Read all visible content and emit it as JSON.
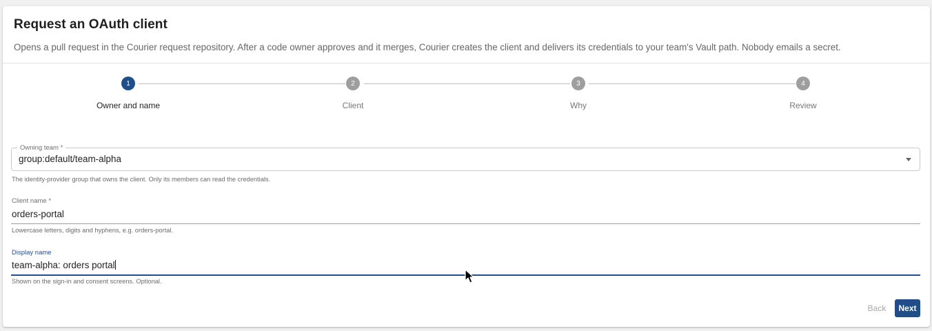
{
  "header": {
    "title": "Request an OAuth client",
    "subtitle": "Opens a pull request in the Courier request repository. After a code owner approves and it merges, Courier creates the client and delivers its credentials to your team's Vault path. Nobody emails a secret."
  },
  "stepper": {
    "active_index": 0,
    "steps": [
      {
        "number": "1",
        "label": "Owner and name"
      },
      {
        "number": "2",
        "label": "Client"
      },
      {
        "number": "3",
        "label": "Why"
      },
      {
        "number": "4",
        "label": "Review"
      }
    ]
  },
  "form": {
    "owning_team": {
      "label": "Owning team *",
      "value": "group:default/team-alpha",
      "helper": "The identity-provider group that owns the client. Only its members can read the credentials."
    },
    "client_name": {
      "label": "Client name *",
      "value": "orders-portal",
      "helper": "Lowercase letters, digits and hyphens, e.g. orders-portal."
    },
    "display_name": {
      "label": "Display name",
      "value": "team-alpha: orders portal",
      "helper": "Shown on the sign-in and consent screens. Optional."
    }
  },
  "actions": {
    "back_label": "Back",
    "next_label": "Next"
  },
  "colors": {
    "accent": "#1f4e89",
    "inactive_step": "#9e9e9e"
  }
}
